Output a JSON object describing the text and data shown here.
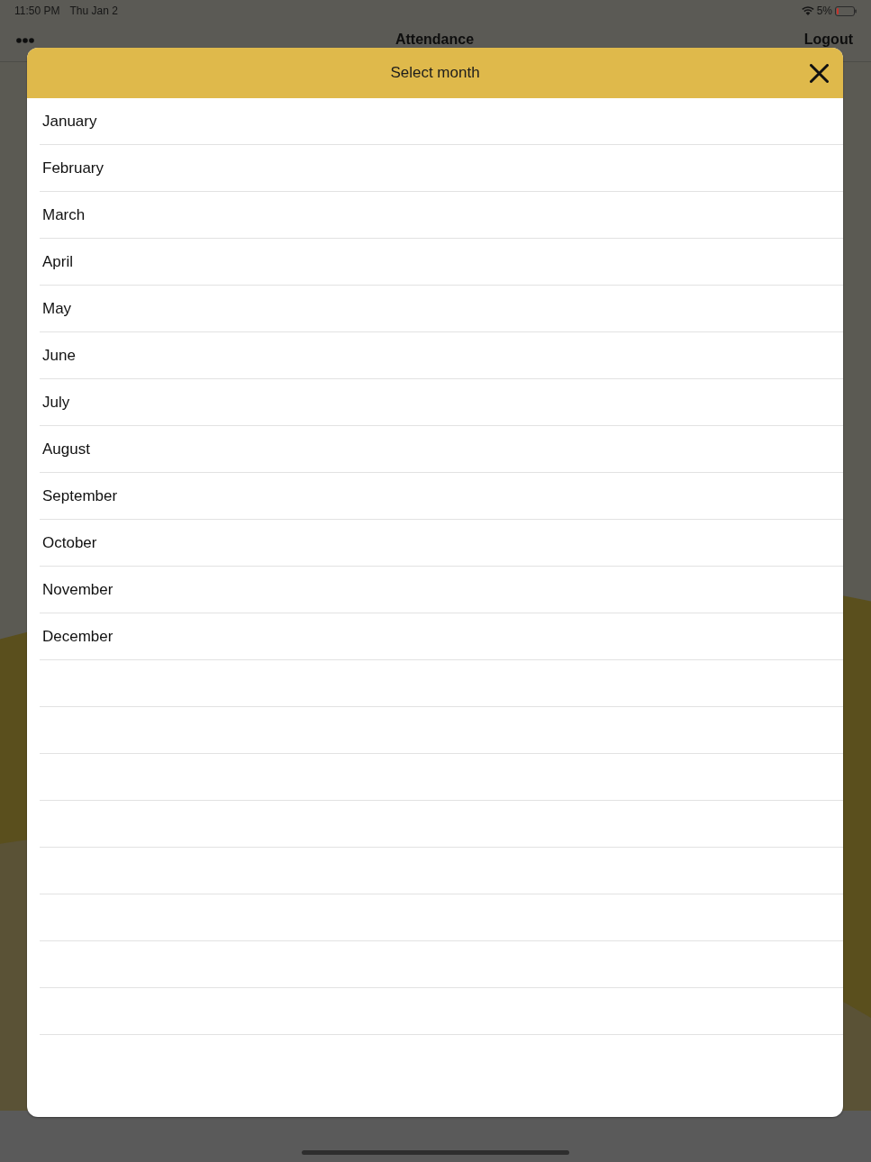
{
  "status_bar": {
    "time": "11:50 PM",
    "date": "Thu Jan 2",
    "battery": "5%"
  },
  "nav_bar": {
    "title": "Attendance",
    "action": "Logout"
  },
  "modal": {
    "title": "Select month",
    "items": [
      {
        "label": "January"
      },
      {
        "label": "February"
      },
      {
        "label": "March"
      },
      {
        "label": "April"
      },
      {
        "label": "May"
      },
      {
        "label": "June"
      },
      {
        "label": "July"
      },
      {
        "label": "August"
      },
      {
        "label": "September"
      },
      {
        "label": "October"
      },
      {
        "label": "November"
      },
      {
        "label": "December"
      }
    ]
  }
}
